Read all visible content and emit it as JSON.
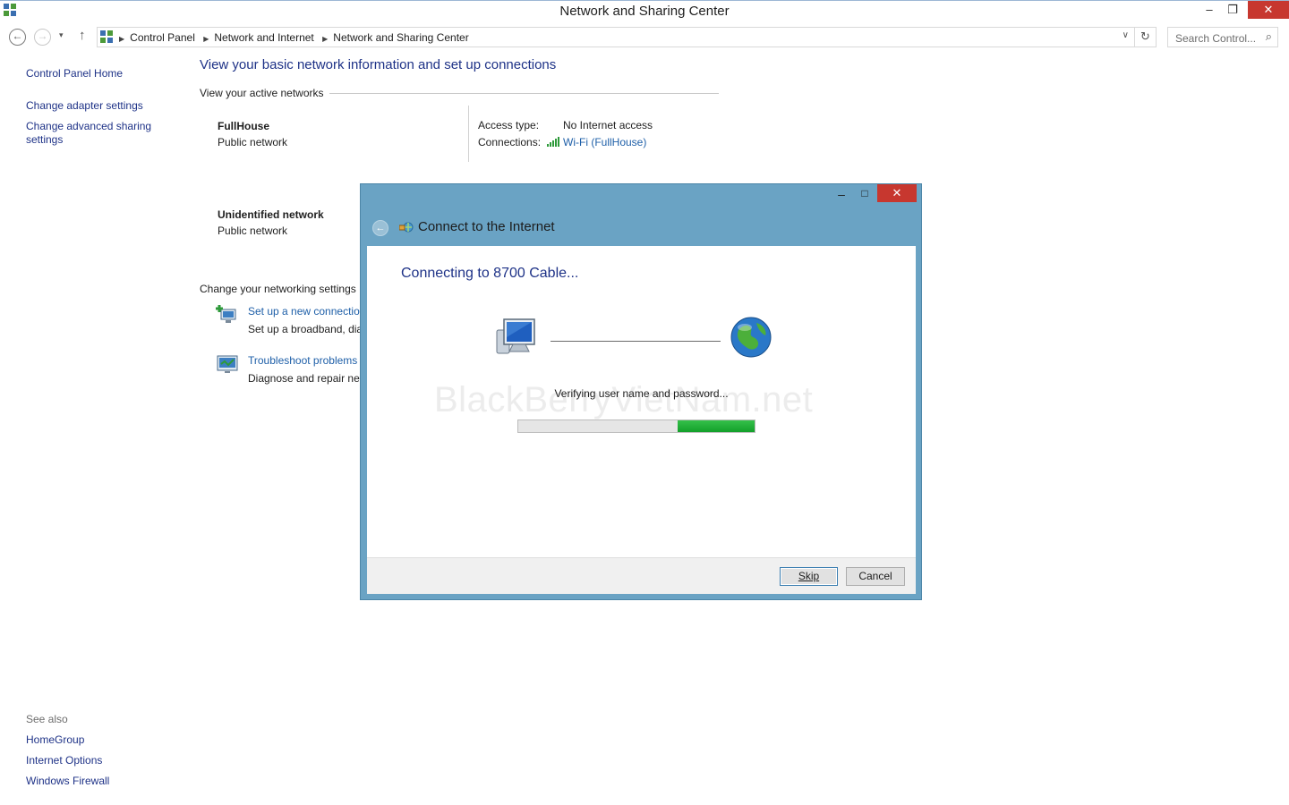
{
  "window": {
    "title": "Network and Sharing Center",
    "controls": {
      "minimize": "–",
      "restore": "❐",
      "close": "✕"
    }
  },
  "nav": {
    "back_icon": "←",
    "forward_icon": "→",
    "recent_icon": "▾",
    "up_icon": "↑",
    "breadcrumbs": [
      "Control Panel",
      "Network and Internet",
      "Network and Sharing Center"
    ],
    "separator": "▶",
    "dropdown_icon": "∨",
    "refresh_icon": "↻",
    "search_placeholder": "Search Control...",
    "search_icon": "⌕"
  },
  "sidebar": {
    "home": "Control Panel Home",
    "items": [
      {
        "label": "Change adapter settings"
      },
      {
        "label": "Change advanced sharing settings"
      }
    ],
    "see_also": {
      "title": "See also",
      "items": [
        {
          "label": "HomeGroup"
        },
        {
          "label": "Internet Options"
        },
        {
          "label": "Windows Firewall"
        }
      ]
    }
  },
  "main": {
    "heading": "View your basic network information and set up connections",
    "active_networks_label": "View your active networks",
    "networks": [
      {
        "name": "FullHouse",
        "type": "Public network",
        "access_label": "Access type:",
        "access_value": "No Internet access",
        "connections_label": "Connections:",
        "connection": "Wi-Fi (FullHouse)"
      },
      {
        "name": "Unidentified network",
        "type": "Public network"
      }
    ],
    "change_settings_label": "Change your networking settings",
    "tasks": [
      {
        "link": "Set up a new connectio",
        "desc": "Set up a broadband, dia"
      },
      {
        "link": "Troubleshoot problems",
        "desc": "Diagnose and repair net"
      }
    ]
  },
  "dialog": {
    "title": "Connect to the Internet",
    "controls": {
      "minimize": "–",
      "maximize": "□",
      "close": "✕"
    },
    "back_icon": "←",
    "status_heading": "Connecting to 8700 Cable...",
    "status_text": "Verifying user name and password...",
    "watermark": "BlackBerryVietNam.net",
    "progress": {
      "segment_start": 0.675,
      "segment_end": 1.0
    },
    "buttons": {
      "skip": "Skip",
      "cancel": "Cancel"
    }
  },
  "colors": {
    "link": "#1e3287",
    "dialog_frame": "#6aa3c4",
    "close_button": "#c7372f",
    "progress_green": "#1fb036"
  }
}
